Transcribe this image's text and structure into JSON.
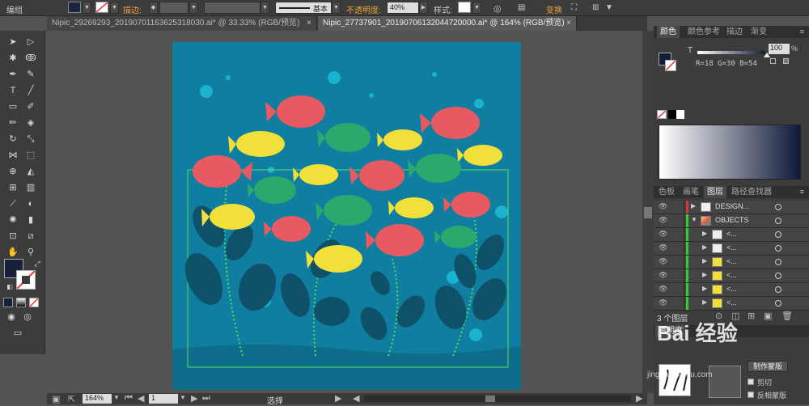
{
  "menu": {
    "label": "编组"
  },
  "control_bar": {
    "stroke_label": "描边:",
    "stroke_style": "基本",
    "opacity_label": "不透明度:",
    "opacity_value": "40%",
    "style_label": "样式:",
    "transform_label": "变换",
    "fill_color": "#1a2540",
    "accent_color": "#e8a23a"
  },
  "tabs": [
    {
      "label": "Nipic_29269293_20190701163625318030.ai* @ 33.33% (RGB/预览)",
      "active": false
    },
    {
      "label": "Nipic_27737901_20190706132044720000.ai* @ 164% (RGB/预览)",
      "active": true
    }
  ],
  "tools": [
    "selection-tool",
    "direct-selection-tool",
    "magic-wand-tool",
    "lasso-tool",
    "pen-tool",
    "curvature-tool",
    "type-tool",
    "line-tool",
    "rectangle-tool",
    "paintbrush-tool",
    "pencil-tool",
    "eraser-tool",
    "rotate-tool",
    "scale-tool",
    "width-tool",
    "free-transform-tool",
    "shape-builder-tool",
    "perspective-tool",
    "mesh-tool",
    "gradient-tool",
    "eyedropper-tool",
    "blend-tool",
    "symbol-sprayer-tool",
    "column-graph-tool",
    "artboard-tool",
    "slice-tool",
    "hand-tool",
    "zoom-tool"
  ],
  "color_panel": {
    "tabs": [
      "颜色",
      "颜色参考",
      "描边",
      "渐变"
    ],
    "t_label": "T",
    "t_value": "100",
    "pct": "%",
    "rgb_readout": "R=18 G=30 B=54",
    "fill": "#121e36"
  },
  "layers_panel": {
    "tabs": [
      "色板",
      "画笔",
      "图层",
      "路径查找器"
    ],
    "rows": [
      {
        "name": "DESIGN...",
        "color": "#d33",
        "expanded": false,
        "thumb": "white",
        "indent": 0
      },
      {
        "name": "OBJECTS",
        "color": "#3c3",
        "expanded": true,
        "thumb": "fish",
        "indent": 0
      },
      {
        "name": "<...",
        "color": "#3c3",
        "expanded": false,
        "thumb": "white",
        "indent": 1
      },
      {
        "name": "<...",
        "color": "#3c3",
        "expanded": false,
        "thumb": "white",
        "indent": 1
      },
      {
        "name": "<...",
        "color": "#3c3",
        "expanded": false,
        "thumb": "yellow",
        "indent": 1
      },
      {
        "name": "<...",
        "color": "#3c3",
        "expanded": false,
        "thumb": "yellow",
        "indent": 1
      },
      {
        "name": "<...",
        "color": "#3c3",
        "expanded": false,
        "thumb": "yellow",
        "indent": 1
      },
      {
        "name": "<...",
        "color": "#3c3",
        "expanded": false,
        "thumb": "yellow",
        "indent": 1
      }
    ],
    "footer": "3 个图层"
  },
  "transparency_panel": {
    "title": "透明度",
    "make_mask": "制作蒙版",
    "clip": "剪切",
    "invert_mask": "反相蒙版"
  },
  "status": {
    "zoom": "164%",
    "page": "1",
    "tool": "选择"
  },
  "watermark": {
    "text": "Bai 经验",
    "sub": "jingyan.baidu.com"
  }
}
